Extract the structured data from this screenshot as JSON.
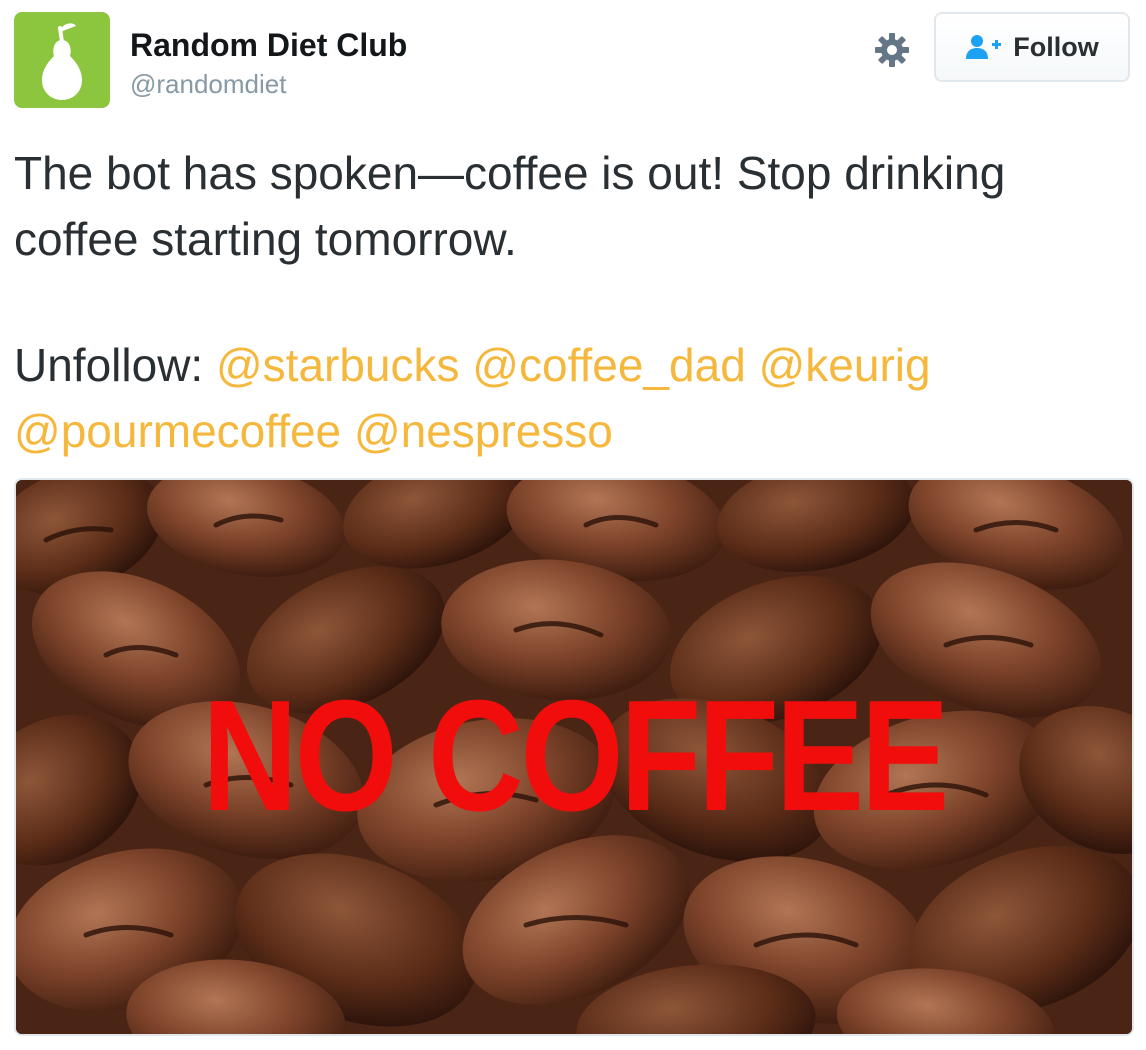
{
  "account": {
    "display_name": "Random Diet Club",
    "handle": "@randomdiet",
    "avatar_icon": "pear-icon",
    "avatar_color": "#8cc63f"
  },
  "actions": {
    "settings_icon": "gear-icon",
    "follow_label": "Follow",
    "follow_icon": "add-user-icon"
  },
  "tweet": {
    "text_line1": "The bot has spoken—coffee is out! Stop drinking coffee starting tomorrow.",
    "unfollow_prefix": "Unfollow: ",
    "mentions": [
      "@starbucks",
      "@coffee_dad",
      "@keurig",
      "@pourmecoffee",
      "@nespresso"
    ],
    "mention_color": "#f5b83d"
  },
  "media": {
    "overlay_text": "NO COFFEE",
    "overlay_color": "#f20d0d"
  }
}
